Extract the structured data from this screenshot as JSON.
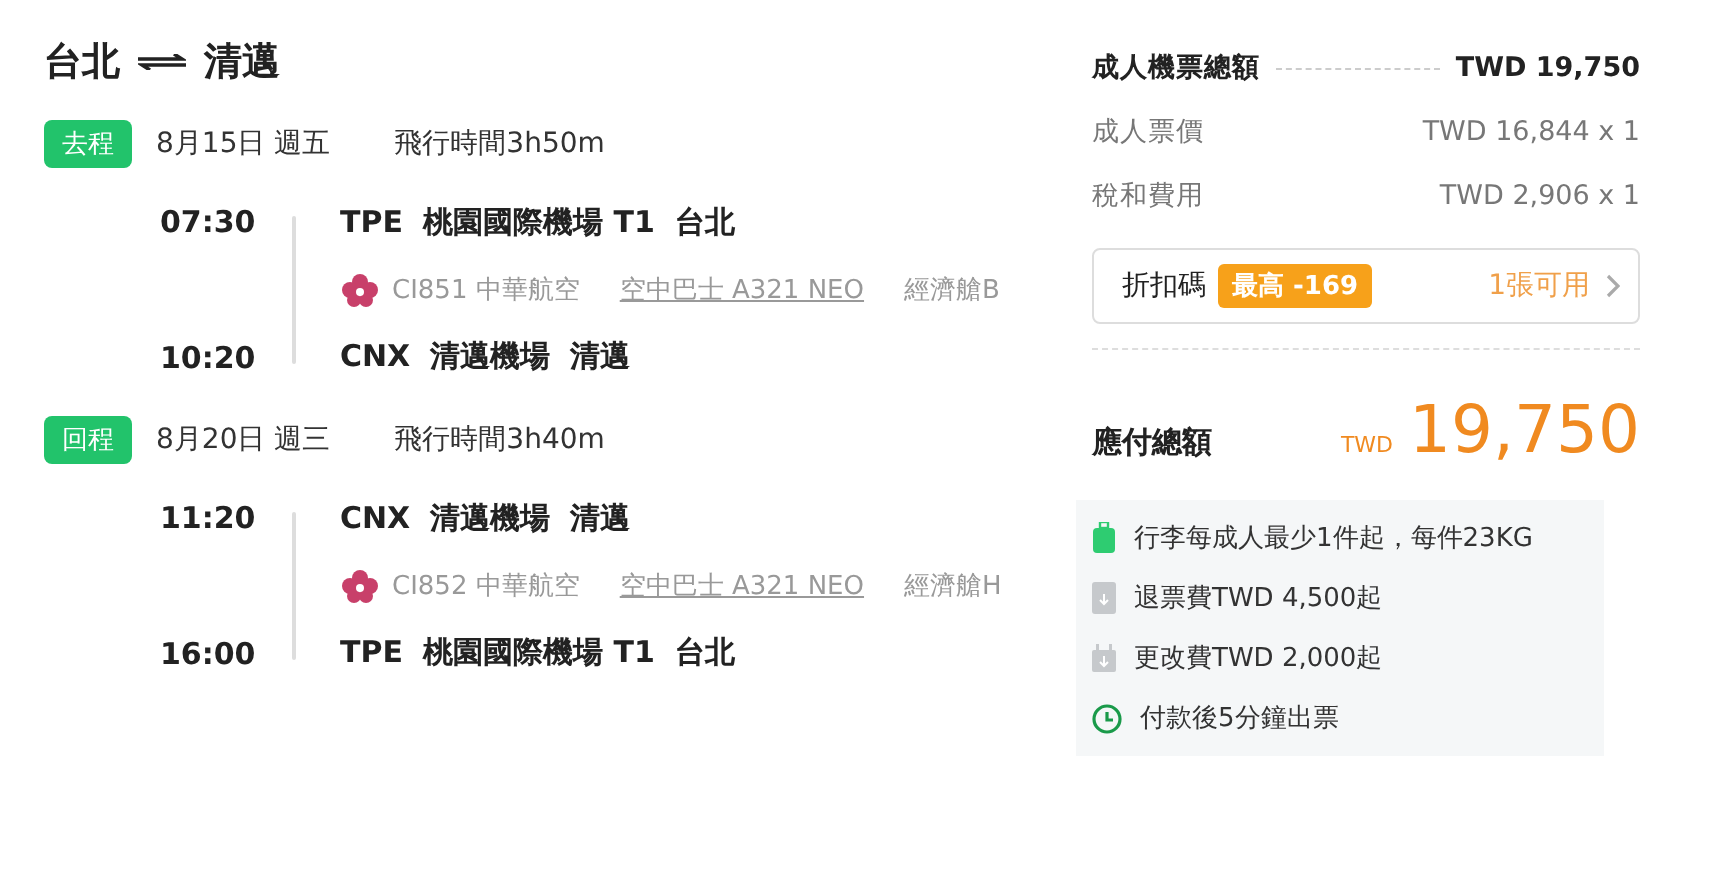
{
  "route": {
    "from": "台北",
    "to": "清邁"
  },
  "legs": [
    {
      "tag": "去程",
      "date": "8月15日 週五",
      "duration": "飛行時間3h50m",
      "depart": {
        "time": "07:30",
        "code": "TPE",
        "airport": "桃園國際機場 T1",
        "city": "台北"
      },
      "flight": "CI851 中華航空",
      "aircraft": "空中巴士 A321 NEO",
      "cabin": "經濟艙B",
      "arrive": {
        "time": "10:20",
        "code": "CNX",
        "airport": "清邁機場",
        "city": "清邁"
      }
    },
    {
      "tag": "回程",
      "date": "8月20日 週三",
      "duration": "飛行時間3h40m",
      "depart": {
        "time": "11:20",
        "code": "CNX",
        "airport": "清邁機場",
        "city": "清邁"
      },
      "flight": "CI852 中華航空",
      "aircraft": "空中巴士 A321 NEO",
      "cabin": "經濟艙H",
      "arrive": {
        "time": "16:00",
        "code": "TPE",
        "airport": "桃園國際機場 T1",
        "city": "台北"
      }
    }
  ],
  "price": {
    "total_label": "成人機票總額",
    "total": "TWD 19,750",
    "lines": [
      {
        "label": "成人票價",
        "value": "TWD 16,844 x 1"
      },
      {
        "label": "稅和費用",
        "value": "TWD 2,906 x 1"
      }
    ]
  },
  "coupon": {
    "label": "折扣碼",
    "badge": "最高 -169",
    "available": "1張可用"
  },
  "payable": {
    "label": "應付總額",
    "currency": "TWD",
    "amount": "19,750"
  },
  "info": [
    {
      "kind": "luggage",
      "text": "行李每成人最少1件起，每件23KG"
    },
    {
      "kind": "refund",
      "text": "退票費TWD 4,500起"
    },
    {
      "kind": "change",
      "text": "更改費TWD 2,000起"
    },
    {
      "kind": "clock",
      "text": "付款後5分鐘出票"
    }
  ]
}
